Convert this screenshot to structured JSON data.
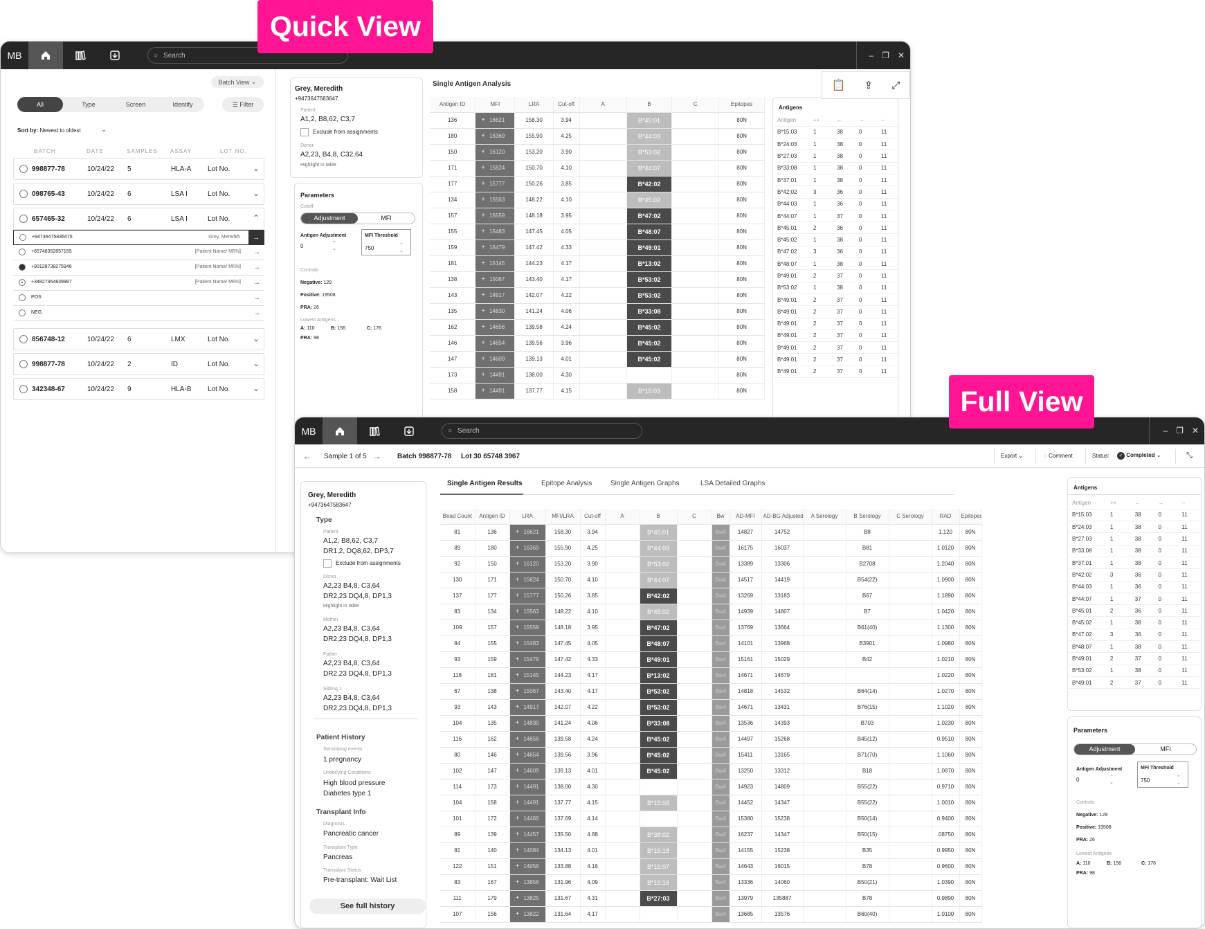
{
  "badges": {
    "quick": "Quick View",
    "full": "Full View"
  },
  "app": {
    "logo": "MB",
    "search_placeholder": "Search"
  },
  "quick": {
    "batch_view": "Batch View",
    "filters": [
      "All",
      "Type",
      "Screen",
      "Identify"
    ],
    "filter_btn": "Filter",
    "sort_label": "Sort by:",
    "sort_value": "Newest to oldest",
    "columns": [
      "BATCH",
      "DATE",
      "SAMPLES",
      "ASSAY",
      "LOT NO."
    ],
    "batches_top": [
      {
        "id": "998877-78",
        "date": "10/24/22",
        "samples": "5",
        "assay": "HLA-A",
        "lot": "Lot No."
      },
      {
        "id": "098765-43",
        "date": "10/24/22",
        "samples": "6",
        "assay": "LSA I",
        "lot": "Lot No."
      },
      {
        "id": "657465-32",
        "date": "10/24/22",
        "samples": "6",
        "assay": "LSA I",
        "lot": "Lot No."
      }
    ],
    "subrows": [
      {
        "id": "+94736475836475",
        "name": "Grey, Meredith"
      },
      {
        "id": "+65746352857155",
        "name": "[Patient Name/ MRN]"
      },
      {
        "id": "+90128738275946",
        "name": "[Patient Name/ MRN]"
      },
      {
        "id": "+34827364839987",
        "name": "[Patient Name/ MRN]"
      },
      {
        "id": "POS",
        "name": ""
      },
      {
        "id": "NEG",
        "name": ""
      }
    ],
    "batches_bottom": [
      {
        "id": "856748-12",
        "date": "10/24/22",
        "samples": "6",
        "assay": "LMX",
        "lot": "Lot No."
      },
      {
        "id": "998877-78",
        "date": "10/24/22",
        "samples": "2",
        "assay": "ID",
        "lot": "Lot No."
      },
      {
        "id": "342348-67",
        "date": "10/24/22",
        "samples": "9",
        "assay": "HLA-B",
        "lot": "Lot No."
      }
    ],
    "patient": {
      "name": "Grey, Meredith",
      "id": "+9473647583647",
      "patient_lbl": "Patient",
      "patient_val": "A1,2, B8,62, C3,7",
      "exclude": "Exclude from assignments",
      "donor_lbl": "Donor",
      "donor_val": "A2,23, B4,8, C32,64",
      "highlight": "Highlight in table"
    },
    "params": {
      "title": "Parameters",
      "cutoff": "Cutoff",
      "tog1": "Adjustment",
      "tog2": "MFI",
      "adj_lbl": "Antigen Adjustment",
      "adj_val": "0",
      "mfi_lbl": "MFI Threshold",
      "mfi_val": "750",
      "controls": "Controls",
      "neg": "Negative:",
      "neg_v": "129",
      "pos": "Positive:",
      "pos_v": "19508",
      "pra": "PRA:",
      "pra_v": "26",
      "lowest": "Lowest Antigens",
      "la": "A:",
      "la_v": "110",
      "lb": "B:",
      "lb_v": "156",
      "lc": "C:",
      "lc_v": "176",
      "pra2": "PRA:",
      "pra2_v": "98"
    },
    "table_title": "Single Antigen Analysis",
    "table_cols": [
      "Antigen ID",
      "MFI",
      "LRA",
      "Cut-off",
      "A",
      "B",
      "C",
      "Epitopes"
    ],
    "rows": [
      [
        "136",
        "16621",
        "158.30",
        "3.94",
        "",
        "B*45:01",
        "",
        "80N",
        "l"
      ],
      [
        "180",
        "16369",
        "155.90",
        "4.25",
        "",
        "B*44:03",
        "",
        "80N",
        "l"
      ],
      [
        "150",
        "16120",
        "153.20",
        "3.90",
        "",
        "B*53:02",
        "",
        "80N",
        "l"
      ],
      [
        "171",
        "15824",
        "150.70",
        "4.10",
        "",
        "B*44:07",
        "",
        "80N",
        "l"
      ],
      [
        "177",
        "15777",
        "150.26",
        "3.85",
        "",
        "B*42:02",
        "",
        "80N",
        "d"
      ],
      [
        "134",
        "15563",
        "148.22",
        "4.10",
        "",
        "B*45:02",
        "",
        "80N",
        "l"
      ],
      [
        "157",
        "15559",
        "148.18",
        "3.95",
        "",
        "B*47:02",
        "",
        "80N",
        "d"
      ],
      [
        "155",
        "15483",
        "147.45",
        "4.05",
        "",
        "B*48:07",
        "",
        "80N",
        "d"
      ],
      [
        "159",
        "15479",
        "147.42",
        "4.33",
        "",
        "B*49:01",
        "",
        "80N",
        "d"
      ],
      [
        "181",
        "15145",
        "144.23",
        "4.17",
        "",
        "B*13:02",
        "",
        "80N",
        "d"
      ],
      [
        "138",
        "15067",
        "143.40",
        "4.17",
        "",
        "B*53:02",
        "",
        "80N",
        "d"
      ],
      [
        "143",
        "14917",
        "142.07",
        "4.22",
        "",
        "B*53:02",
        "",
        "80N",
        "d"
      ],
      [
        "135",
        "14830",
        "141.24",
        "4.06",
        "",
        "B*33:08",
        "",
        "80N",
        "d"
      ],
      [
        "162",
        "14656",
        "139.58",
        "4.24",
        "",
        "B*45:02",
        "",
        "80N",
        "d"
      ],
      [
        "146",
        "14654",
        "139.56",
        "3.96",
        "",
        "B*45:02",
        "",
        "80N",
        "d"
      ],
      [
        "147",
        "14609",
        "139.13",
        "4.01",
        "",
        "B*45:02",
        "",
        "80N",
        "d"
      ],
      [
        "173",
        "14491",
        "138.00",
        "4.30",
        "",
        "",
        "",
        "80N",
        ""
      ],
      [
        "158",
        "14491",
        "137.77",
        "4.15",
        "",
        "B*15:03",
        "",
        "80N",
        "l"
      ]
    ],
    "antigens_title": "Antigens",
    "antigen_cols": [
      "Antigen",
      "++",
      "←",
      "→",
      "--"
    ],
    "antigens": [
      [
        "B*15:03",
        "1",
        "38",
        "0",
        "11"
      ],
      [
        "B*24:03",
        "1",
        "38",
        "0",
        "11"
      ],
      [
        "B*27:03",
        "1",
        "38",
        "0",
        "11"
      ],
      [
        "B*33:08",
        "1",
        "38",
        "0",
        "11"
      ],
      [
        "B*37:01",
        "1",
        "38",
        "0",
        "11"
      ],
      [
        "B*42:02",
        "3",
        "36",
        "0",
        "11"
      ],
      [
        "B*44:03",
        "1",
        "36",
        "0",
        "11"
      ],
      [
        "B*44:07",
        "1",
        "37",
        "0",
        "11"
      ],
      [
        "B*45:01",
        "2",
        "36",
        "0",
        "11"
      ],
      [
        "B*45:02",
        "1",
        "38",
        "0",
        "11"
      ],
      [
        "B*47:02",
        "3",
        "36",
        "0",
        "11"
      ],
      [
        "B*48:07",
        "1",
        "38",
        "0",
        "11"
      ],
      [
        "B*49:01",
        "2",
        "37",
        "0",
        "11"
      ],
      [
        "B*53:02",
        "1",
        "38",
        "0",
        "11"
      ],
      [
        "B*49:01",
        "2",
        "37",
        "0",
        "11"
      ],
      [
        "B*49:01",
        "2",
        "37",
        "0",
        "11"
      ],
      [
        "B*49:01",
        "2",
        "37",
        "0",
        "11"
      ],
      [
        "B*49:01",
        "2",
        "37",
        "0",
        "11"
      ],
      [
        "B*49:01",
        "2",
        "37",
        "0",
        "11"
      ],
      [
        "B*49:01",
        "2",
        "37",
        "0",
        "11"
      ],
      [
        "B*49:01",
        "2",
        "37",
        "0",
        "11"
      ]
    ]
  },
  "full": {
    "sample": "Sample 1 of 5",
    "batch": "Batch 998877-78",
    "lot": "Lot 30 65748 3967",
    "export": "Export",
    "comment": "Comment",
    "status_lbl": "Status:",
    "status_val": "Completed",
    "tabs": [
      "Single Antigen Results",
      "Epitope Analysis",
      "Single Antigen Graphs",
      "LSA Detailed Graphs"
    ],
    "patient": {
      "name": "Grey, Meredith",
      "id": "+9473647583647",
      "type": "Type",
      "patient_lbl": "Patient",
      "patient_l1": "A1,2, B8,62, C3,7",
      "patient_l2": "DR1,2, DQ8,62, DP3,7",
      "exclude": "Exclude from assignments",
      "donor_lbl": "Donor",
      "donor_l1": "A2,23 B4,8, C3,64",
      "donor_l2": "DR2,23 DQ4,8, DP1,3",
      "highlight": "Highlight in table",
      "mother_lbl": "Mother",
      "mother_l1": "A2,23 B4,8, C3,64",
      "mother_l2": "DR2,23 DQ4,8, DP1,3",
      "father_lbl": "Father",
      "father_l1": "A2,23 B4,8, C3,64",
      "father_l2": "DR2,23 DQ4,8, DP1,3",
      "sibling_lbl": "Sibling 1",
      "sibling_l1": "A2,23 B4,8, C3,64",
      "sibling_l2": "DR2,23 DQ4,8, DP1,3",
      "history": "Patient History",
      "sens_lbl": "Sensitizing events",
      "sens_val": "1 pregnancy",
      "cond_lbl": "Underlying Conditions",
      "cond_v1": "High blood pressure",
      "cond_v2": "Diabetes type 1",
      "tx": "Transplant Info",
      "diag_lbl": "Diagnosis",
      "diag_val": "Pancreatic cancer",
      "txtype_lbl": "Transplant Type",
      "txtype_val": "Pancreas",
      "txstatus_lbl": "Transplant Status",
      "txstatus_val": "Pre-transplant: Wait List",
      "history_btn": "See full history"
    },
    "table_cols": [
      "Bead Count",
      "Antigen ID",
      "LRA",
      "MFI/LRA",
      "Cut-off",
      "A",
      "B",
      "C",
      "Bw",
      "AD-MFI",
      "AD-BG Adjusted",
      "A Serology",
      "B Serology",
      "C Serology",
      "RAD",
      "Epitopes"
    ],
    "rows": [
      [
        "81",
        "136",
        "16621",
        "158.30",
        "3.94",
        "",
        "B*45:01",
        "",
        "Bw4",
        "14827",
        "14752",
        "",
        "B8",
        "",
        "1.120",
        "80N",
        "l"
      ],
      [
        "89",
        "180",
        "16369",
        "155.90",
        "4.25",
        "",
        "B*44:03",
        "",
        "Bw4",
        "16175",
        "16037",
        "",
        "B81",
        "",
        "1.0120",
        "80N",
        "l"
      ],
      [
        "92",
        "150",
        "16120",
        "153.20",
        "3.90",
        "",
        "B*53:02",
        "",
        "Bw4",
        "13389",
        "13306",
        "",
        "B2708",
        "",
        "1.2040",
        "80N",
        "l"
      ],
      [
        "130",
        "171",
        "15824",
        "150.70",
        "4.10",
        "",
        "B*44:07",
        "",
        "Bw4",
        "14517",
        "14419",
        "",
        "B54(22)",
        "",
        "1.0900",
        "80N",
        "l"
      ],
      [
        "137",
        "177",
        "15777",
        "150.26",
        "3.85",
        "",
        "B*42:02",
        "",
        "Bw4",
        "13269",
        "13183",
        "",
        "B67",
        "",
        "1.1890",
        "80N",
        "d"
      ],
      [
        "83",
        "134",
        "15563",
        "148.22",
        "4.10",
        "",
        "B*45:02",
        "",
        "Bw4",
        "14939",
        "14807",
        "",
        "B7",
        "",
        "1.0420",
        "80N",
        "l"
      ],
      [
        "109",
        "157",
        "15559",
        "148.18",
        "3.95",
        "",
        "B*47:02",
        "",
        "Bw4",
        "13769",
        "13664",
        "",
        "B61(40)",
        "",
        "1.1300",
        "80N",
        "d"
      ],
      [
        "84",
        "155",
        "15483",
        "147.45",
        "4.05",
        "",
        "B*48:07",
        "",
        "Bw4",
        "14101",
        "13968",
        "",
        "B3901",
        "",
        "1.0980",
        "80N",
        "d"
      ],
      [
        "93",
        "159",
        "15479",
        "147.42",
        "4.33",
        "",
        "B*49:01",
        "",
        "Bw4",
        "15161",
        "15029",
        "",
        "B42",
        "",
        "1.0210",
        "80N",
        "d"
      ],
      [
        "118",
        "181",
        "15145",
        "144.23",
        "4.17",
        "",
        "B*13:02",
        "",
        "Bw4",
        "14671",
        "14679",
        "",
        "",
        "",
        "1.0220",
        "80N",
        "d"
      ],
      [
        "67",
        "138",
        "15067",
        "143.40",
        "4.17",
        "",
        "B*53:02",
        "",
        "Bw4",
        "14818",
        "14532",
        "",
        "B64(14)",
        "",
        "1.0270",
        "80N",
        "d"
      ],
      [
        "93",
        "143",
        "14917",
        "142.07",
        "4.22",
        "",
        "B*53:02",
        "",
        "Bw4",
        "14671",
        "13431",
        "",
        "B76(15)",
        "",
        "1.1020",
        "80N",
        "d"
      ],
      [
        "104",
        "135",
        "14830",
        "141.24",
        "4.06",
        "",
        "B*33:08",
        "",
        "Bw4",
        "13536",
        "14393",
        "",
        "B703",
        "",
        "1.0230",
        "80N",
        "d"
      ],
      [
        "116",
        "162",
        "14656",
        "139.58",
        "4.24",
        "",
        "B*45:02",
        "",
        "Bw4",
        "14497",
        "15268",
        "",
        "B45(12)",
        "",
        "0.9510",
        "80N",
        "d"
      ],
      [
        "80",
        "146",
        "14654",
        "139.56",
        "3.96",
        "",
        "B*45:02",
        "",
        "Bw4",
        "15411",
        "13165",
        "",
        "B71(70)",
        "",
        "1.1060",
        "80N",
        "d"
      ],
      [
        "102",
        "147",
        "14609",
        "139.13",
        "4.01",
        "",
        "B*45:02",
        "",
        "Bw4",
        "13250",
        "13312",
        "",
        "B18",
        "",
        "1.0870",
        "80N",
        "d"
      ],
      [
        "114",
        "173",
        "14491",
        "138.00",
        "4.30",
        "",
        "",
        "",
        "Bw4",
        "14923",
        "14809",
        "",
        "B55(22)",
        "",
        "0.9710",
        "80N",
        ""
      ],
      [
        "104",
        "158",
        "14491",
        "137.77",
        "4.15",
        "",
        "B*15:03",
        "",
        "Bw4",
        "14452",
        "14347",
        "",
        "B55(22)",
        "",
        "1.0010",
        "80N",
        "l"
      ],
      [
        "101",
        "172",
        "14466",
        "137.69",
        "4.14",
        "",
        "",
        "",
        "Bw4",
        "15380",
        "15238",
        "",
        "B50(14)",
        "",
        "0.9400",
        "80N",
        ""
      ],
      [
        "89",
        "139",
        "14457",
        "135.50",
        "4.88",
        "",
        "B*38:02",
        "",
        "Bw4",
        "16237",
        "14347",
        "",
        "B50(15)",
        "",
        ".08750",
        "80N",
        "l"
      ],
      [
        "81",
        "140",
        "14084",
        "134.13",
        "4.01",
        "",
        "B*15:18",
        "",
        "Bw4",
        "14155",
        "15238",
        "",
        "B35",
        "",
        "0.9950",
        "80N",
        "l"
      ],
      [
        "122",
        "151",
        "14058",
        "133.88",
        "4.16",
        "",
        "B*15:07",
        "",
        "Bw4",
        "14643",
        "16015",
        "",
        "B78",
        "",
        "0.9600",
        "80N",
        "l"
      ],
      [
        "83",
        "167",
        "13856",
        "131.96",
        "4.09",
        "",
        "B*15:16",
        "",
        "Bw4",
        "13336",
        "14060",
        "",
        "B50(21)",
        "",
        "1.0390",
        "80N",
        "l"
      ],
      [
        "111",
        "179",
        "13825",
        "131.67",
        "4.31",
        "",
        "B*27:03",
        "",
        "Bw4",
        "13979",
        "135887",
        "",
        "B78",
        "",
        "0.9890",
        "80N",
        "d"
      ],
      [
        "107",
        "156",
        "13822",
        "131.64",
        "4.17",
        "",
        "",
        "",
        "Bw4",
        "13685",
        "13576",
        "",
        "B60(40)",
        "",
        "1.0100",
        "80N",
        ""
      ]
    ],
    "antigens_title": "Antigens",
    "antigen_cols": [
      "Antigen",
      "++",
      "←",
      "→",
      "--"
    ],
    "antigens": [
      [
        "B*15:03",
        "1",
        "38",
        "0",
        "11"
      ],
      [
        "B*24:03",
        "1",
        "38",
        "0",
        "11"
      ],
      [
        "B*27:03",
        "1",
        "38",
        "0",
        "11"
      ],
      [
        "B*33:08",
        "1",
        "38",
        "0",
        "11"
      ],
      [
        "B*37:01",
        "1",
        "38",
        "0",
        "11"
      ],
      [
        "B*42:02",
        "3",
        "36",
        "0",
        "11"
      ],
      [
        "B*44:03",
        "1",
        "36",
        "0",
        "11"
      ],
      [
        "B*44:07",
        "1",
        "37",
        "0",
        "11"
      ],
      [
        "B*45:01",
        "2",
        "36",
        "0",
        "11"
      ],
      [
        "B*45:02",
        "1",
        "38",
        "0",
        "11"
      ],
      [
        "B*47:02",
        "3",
        "36",
        "0",
        "11"
      ],
      [
        "B*48:07",
        "1",
        "38",
        "0",
        "11"
      ],
      [
        "B*49:01",
        "2",
        "37",
        "0",
        "11"
      ],
      [
        "B*53:02",
        "1",
        "38",
        "0",
        "11"
      ],
      [
        "B*49:01",
        "2",
        "37",
        "0",
        "11"
      ]
    ],
    "params": {
      "title": "Parameters",
      "tog1": "Adjustment",
      "tog2": "MFI",
      "adj_lbl": "Antigen Adjustment",
      "adj_val": "0",
      "mfi_lbl": "MFI Threshold",
      "mfi_val": "750",
      "controls": "Controls",
      "neg": "Negative:",
      "neg_v": "129",
      "pos": "Positive:",
      "pos_v": "19508",
      "pra": "PRA:",
      "pra_v": "26",
      "lowest": "Lowest Antigens",
      "la": "A:",
      "la_v": "110",
      "lb": "B:",
      "lb_v": "156",
      "lc": "C:",
      "lc_v": "176",
      "pra2": "PRA:",
      "pra2_v": "98"
    }
  }
}
